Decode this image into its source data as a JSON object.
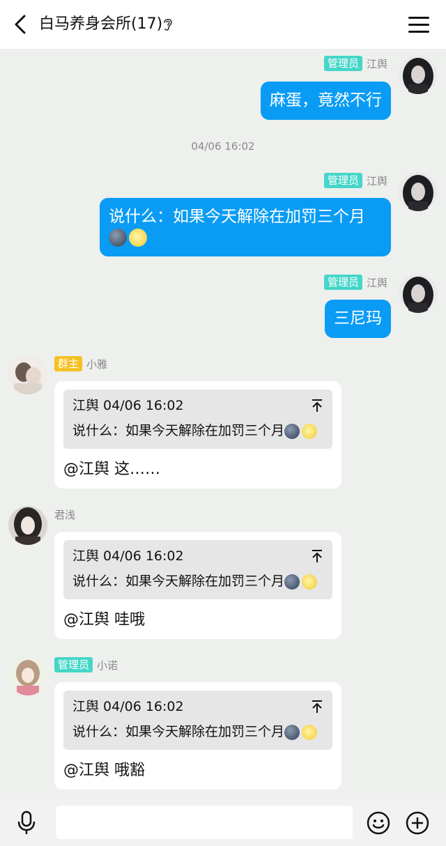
{
  "header": {
    "title": "白马养身会所(17)"
  },
  "messages": {
    "m1": {
      "badge": "管理员",
      "sender": "江舆",
      "text": "麻蛋，竟然不行"
    },
    "timestamp": "04/06 16:02",
    "m2": {
      "badge": "管理员",
      "sender": "江舆",
      "text": "说什么：如果今天解除在加罚三个月"
    },
    "m3": {
      "badge": "管理员",
      "sender": "江舆",
      "text": "三尼玛"
    },
    "m4": {
      "badge": "群主",
      "sender": "小雅",
      "quote_head": "江舆 04/06 16:02",
      "quote_text": "说什么：如果今天解除在加罚三个月",
      "reply": "@江舆 这……"
    },
    "m5": {
      "sender": "君浅",
      "quote_head": "江舆 04/06 16:02",
      "quote_text": "说什么：如果今天解除在加罚三个月",
      "reply": "@江舆 哇哦"
    },
    "m6": {
      "badge": "管理员",
      "sender": "小诺",
      "quote_head": "江舆 04/06 16:02",
      "quote_text": "说什么：如果今天解除在加罚三个月",
      "reply": "@江舆 哦豁"
    }
  },
  "input": {
    "value": ""
  },
  "icons": {
    "back": "back-arrow-icon",
    "ear": "ear-icon",
    "menu": "menu-icon",
    "jump": "jump-to-top-icon",
    "mic": "microphone-icon",
    "emoji": "smiley-icon",
    "plus": "plus-icon"
  },
  "colors": {
    "outgoing_bubble": "#0a9cf5",
    "admin_badge": "#46d6c8",
    "owner_badge": "#f5c023",
    "background": "#edf0ed"
  }
}
